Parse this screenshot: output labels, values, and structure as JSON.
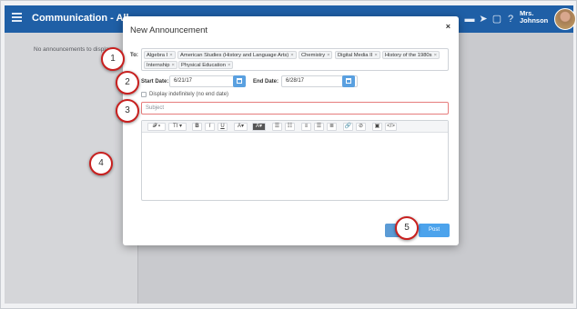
{
  "header": {
    "title": "Communication - All",
    "user_name_line1": "Mrs.",
    "user_name_line2": "Johnson",
    "icons": [
      "menu-icon",
      "chat-icon",
      "send-icon",
      "clipboard-icon",
      "help-icon"
    ]
  },
  "sidebar": {
    "empty_text": "No announcements to display"
  },
  "modal": {
    "title": "New Announcement",
    "close_label": "×",
    "to_label": "To:",
    "recipients": [
      "Algebra I",
      "American Studies (History and Language Arts)",
      "Chemistry",
      "Digital Media II",
      "History of the 1980s",
      "Internship",
      "Physical Education"
    ],
    "start_label": "Start Date:",
    "start_value": "6/21/17",
    "end_label": "End Date:",
    "end_value": "6/28/17",
    "indefinite_label": "Display indefinitely (no end date)",
    "subject_placeholder": "Subject",
    "toolbar": {
      "font_label": "𝓕 ▾",
      "size_label": "TI ▾",
      "bold_label": "B",
      "italic_label": "I",
      "underline_label": "U",
      "color_label": "A▾",
      "bg_label": "A▾",
      "ul_label": "☰",
      "ol_label": "☷",
      "align_left_label": "≡",
      "align_center_label": "☰",
      "align_right_label": "≣",
      "link_label": "🔗",
      "unlink_label": "⊘",
      "image_label": "▣",
      "code_label": "</>"
    },
    "post_label": "Post"
  },
  "callouts": [
    "1",
    "2",
    "3",
    "4",
    "5"
  ],
  "colors": {
    "header_bg": "#1f5fa6",
    "primary_button": "#4ca3ec",
    "callout_ring": "#c8201f",
    "error_border": "#e67c7c"
  }
}
